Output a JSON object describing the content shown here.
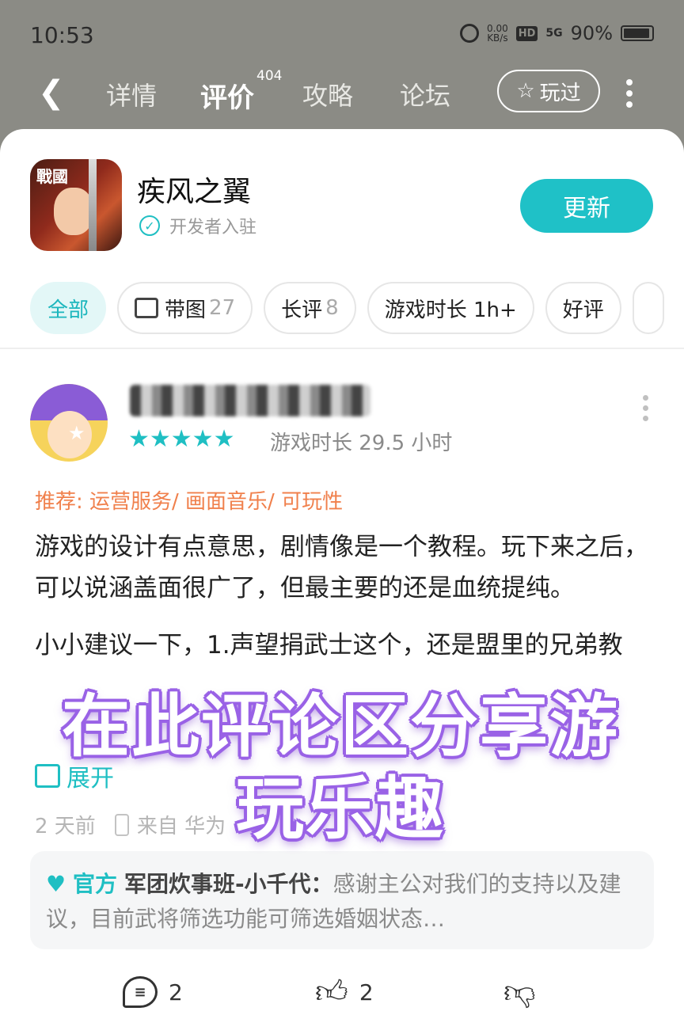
{
  "status_bar": {
    "time": "10:53",
    "net_speed": "0.00",
    "net_unit": "KB/s",
    "hd": "HD",
    "signal": "5G",
    "battery": "90%"
  },
  "nav": {
    "tabs": [
      {
        "label": "详情"
      },
      {
        "label": "评价"
      },
      {
        "label": "攻略"
      },
      {
        "label": "论坛"
      }
    ],
    "review_count": "404",
    "played_label": "玩过"
  },
  "app": {
    "icon_text": "戰國",
    "name": "疾风之翼",
    "developer_label": "开发者入驻",
    "update_label": "更新"
  },
  "filters": [
    {
      "label": "全部",
      "count": ""
    },
    {
      "label": "带图",
      "count": "27"
    },
    {
      "label": "长评",
      "count": "8"
    },
    {
      "label": "游戏时长 1h+",
      "count": ""
    },
    {
      "label": "好评",
      "count": ""
    }
  ],
  "review": {
    "rating": 5,
    "stars": "★★★★★",
    "playtime": "游戏时长 29.5 小时",
    "recommend": "推荐: 运营服务/ 画面音乐/ 可玩性",
    "paragraph1": "游戏的设计有点意思，剧情像是一个教程。玩下来之后，可以说涵盖面很广了，但最主要的还是血统提纯。",
    "paragraph2": "小小建议一下，1.声望捐武士这个，还是盟里的兄弟教",
    "expand_label": "展开",
    "time_ago": "2 天前",
    "device": "来自 华为"
  },
  "official_reply": {
    "badge": "官方",
    "author": "军团炊事班-小千代：",
    "text": "感谢主公对我们的支持以及建议，目前武将筛选功能可筛选婚姻状态…"
  },
  "actions": {
    "comments": "2",
    "likes": "2"
  },
  "overlay": {
    "line1": "在此评论区分享游",
    "line2": "玩乐趣"
  },
  "colors": {
    "accent": "#1fc1c7",
    "recommend": "#f0804c",
    "overlay_stroke": "#9a63e6",
    "header_bg": "#8b8b85"
  }
}
